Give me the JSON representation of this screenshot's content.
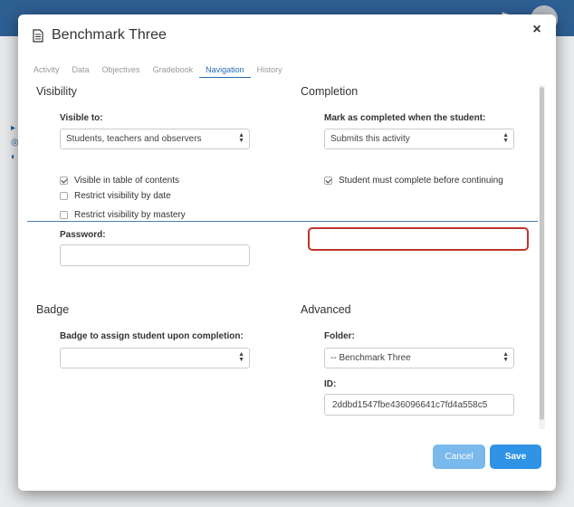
{
  "modal": {
    "title": "Benchmark Three",
    "close_glyph": "×"
  },
  "tabs": [
    {
      "label": "Activity"
    },
    {
      "label": "Data"
    },
    {
      "label": "Objectives"
    },
    {
      "label": "Gradebook"
    },
    {
      "label": "Navigation",
      "active": true
    },
    {
      "label": "History"
    }
  ],
  "visibility": {
    "section_title": "Visibility",
    "visible_to_label": "Visible to:",
    "visible_to_value": "Students, teachers and observers",
    "options": [
      {
        "label": "Visible in table of contents",
        "checked": true
      },
      {
        "label": "Restrict visibility by date",
        "checked": false
      },
      {
        "label": "Restrict visibility by mastery",
        "checked": false
      }
    ],
    "password_label": "Password:",
    "password_value": ""
  },
  "completion": {
    "section_title": "Completion",
    "mark_label": "Mark as completed when the student:",
    "mark_value": "Submits this activity",
    "must_complete_label": "Student must complete before continuing",
    "must_complete_checked": true
  },
  "badge": {
    "section_title": "Badge",
    "assign_label": "Badge to assign student upon completion:",
    "assign_value": ""
  },
  "advanced": {
    "section_title": "Advanced",
    "folder_label": "Folder:",
    "folder_value": "-- Benchmark Three",
    "id_label": "ID:",
    "id_value": "2ddbd1547fbe436096641c7fd4a558c5"
  },
  "footer": {
    "cancel_label": "Cancel",
    "save_label": "Save"
  },
  "colors": {
    "accent": "#2f93e6",
    "highlight_border": "#c0342e",
    "tab_active": "#2a6db5"
  }
}
